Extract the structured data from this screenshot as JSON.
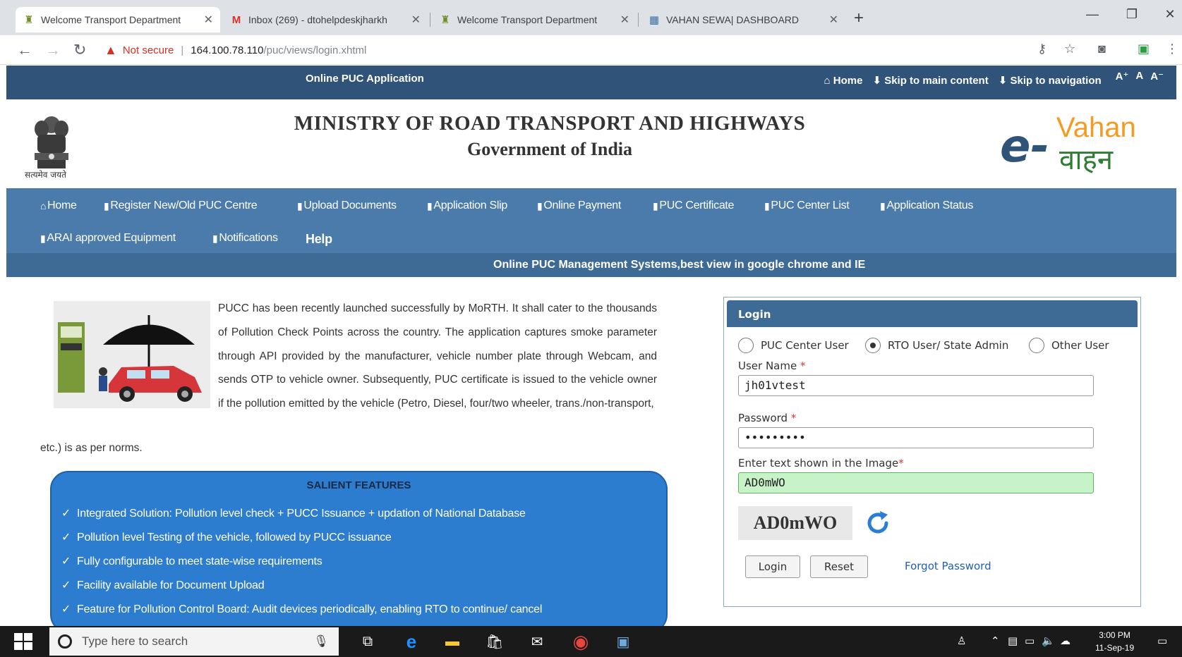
{
  "browser": {
    "tabs": [
      {
        "title": "Welcome Transport Department",
        "icon": "emblem-favicon-icon",
        "active": true
      },
      {
        "title": "Inbox (269) - dtohelpdeskjharkh",
        "icon": "gmail-icon",
        "active": false
      },
      {
        "title": "Welcome Transport Department",
        "icon": "emblem-favicon-icon",
        "active": false
      },
      {
        "title": "VAHAN SEWA| DASHBOARD",
        "icon": "dashboard-favicon-icon",
        "active": false
      }
    ],
    "not_secure": "Not secure",
    "url_host": "164.100.78.110",
    "url_path": "/puc/views/login.xhtml"
  },
  "topbar": {
    "app_title": "Online PUC Application",
    "home": "Home",
    "skip_main": "Skip to main content",
    "skip_nav": "Skip to navigation",
    "font_large": "A⁺",
    "font_normal": "A",
    "font_small": "A⁻"
  },
  "header": {
    "emblem_caption": "सत्यमेव जयते",
    "ministry": "MINISTRY OF ROAD TRANSPORT AND HIGHWAYS",
    "government": "Government of India",
    "logo_e": "e-",
    "logo_vahan": "Vahan",
    "logo_hindi": "वाहन"
  },
  "nav": {
    "home": "Home",
    "register": "Register New/Old PUC Centre",
    "upload": "Upload Documents",
    "app_slip": "Application Slip",
    "payment": "Online Payment",
    "certificate": "PUC Certificate",
    "center_list": "PUC Center List",
    "app_status": "Application Status",
    "arai": "ARAI approved Equipment",
    "notifications": "Notifications",
    "help": "Help"
  },
  "marquee": "Online PUC Management Systems,best view in google chrome and IE",
  "intro": {
    "text": "PUCC has been recently launched successfully by MoRTH. It shall cater to the thousands of Pollution Check Points across the country. The application captures smoke parameter through API provided by the manufacturer, vehicle number plate through Webcam, and sends OTP to vehicle owner. Subsequently, PUC certificate is issued to the vehicle owner if the pollution emitted by the vehicle (Petro, Diesel, four/two wheeler, trans./non-transport,",
    "tail": "etc.) is as per norms."
  },
  "features": {
    "title": "SALIENT FEATURES",
    "items": [
      "Integrated Solution: Pollution level check + PUCC Issuance + updation of National Database",
      "Pollution level Testing of the vehicle, followed by PUCC issuance",
      "Fully configurable to meet state-wise requirements",
      "Facility available for Document Upload",
      "Feature for Pollution Control Board: Audit devices periodically, enabling RTO to continue/ cancel"
    ]
  },
  "login": {
    "title": "Login",
    "options": [
      "PUC Center User",
      "RTO User/ State Admin",
      "Other User"
    ],
    "selected_option": 1,
    "username_label": "User Name",
    "username_value": "jh01vtest",
    "password_label": "Password",
    "password_value": "•••••••••",
    "captcha_label": "Enter text shown in the Image",
    "captcha_value": "AD0mWO",
    "captcha_image_text": "AD0mWO",
    "login_btn": "Login",
    "reset_btn": "Reset",
    "forgot": "Forgot Password"
  },
  "taskbar": {
    "search_placeholder": "Type here to search",
    "time": "3:00 PM",
    "date": "11-Sep-19"
  }
}
